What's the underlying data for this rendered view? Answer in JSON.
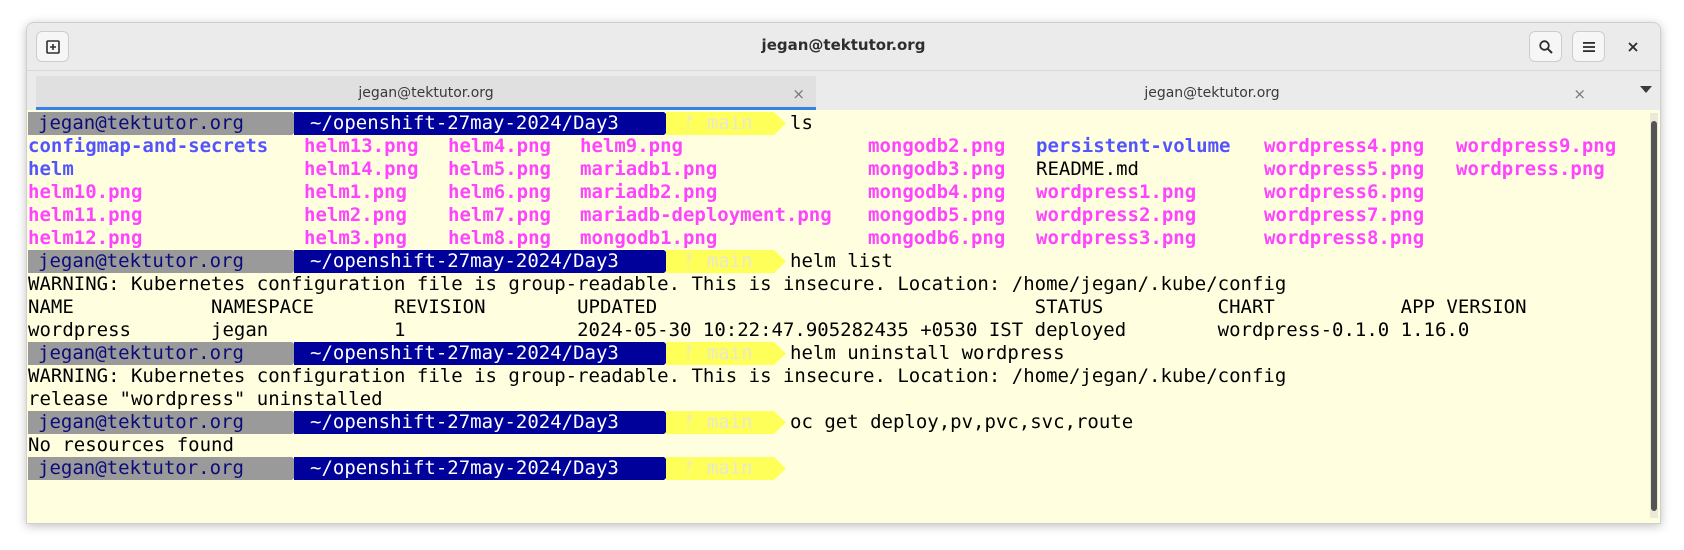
{
  "window": {
    "title": "jegan@tektutor.org"
  },
  "titlebar": {
    "new_tab_icon": "new-tab-icon",
    "search_icon": "search-icon",
    "menu_icon": "hamburger-menu-icon",
    "close_icon": "close-icon"
  },
  "tabs": [
    {
      "label": "jegan@tektutor.org",
      "close": "×",
      "active": true
    },
    {
      "label": "jegan@tektutor.org",
      "close": "×",
      "active": false
    }
  ],
  "prompt": {
    "user": "jegan@tektutor.org",
    "dir": "~/openshift-27may-2024/Day3",
    "git": "ᚠ main"
  },
  "colors": {
    "terminal_bg": "#ffffe0",
    "prompt_user_bg": "#9a9a9a",
    "prompt_dir_bg": "#00009a",
    "prompt_git_bg": "#ffff5a",
    "dir_color": "#5454ff",
    "png_color": "#ff44ff"
  },
  "commands": {
    "c1": "ls",
    "c2": "helm list",
    "c3": "helm uninstall wordpress",
    "c4": "oc get deploy,pv,pvc,svc,route"
  },
  "ls": {
    "col1": [
      "configmap-and-secrets",
      "helm",
      "helm10.png",
      "helm11.png",
      "helm12.png"
    ],
    "col2": [
      "helm13.png",
      "helm14.png",
      "helm1.png",
      "helm2.png",
      "helm3.png"
    ],
    "col3": [
      "helm4.png",
      "helm5.png",
      "helm6.png",
      "helm7.png",
      "helm8.png"
    ],
    "col4": [
      "helm9.png",
      "mariadb1.png",
      "mariadb2.png",
      "mariadb-deployment.png",
      "mongodb1.png"
    ],
    "col5": [
      "mongodb2.png",
      "mongodb3.png",
      "mongodb4.png",
      "mongodb5.png",
      "mongodb6.png"
    ],
    "col6": [
      "persistent-volume",
      "README.md",
      "wordpress1.png",
      "wordpress2.png",
      "wordpress3.png"
    ],
    "col7": [
      "wordpress4.png",
      "wordpress5.png",
      "wordpress6.png",
      "wordpress7.png",
      "wordpress8.png"
    ],
    "col8": [
      "wordpress9.png",
      "wordpress.png"
    ]
  },
  "output": {
    "warning": "WARNING: Kubernetes configuration file is group-readable. This is insecure. Location: /home/jegan/.kube/config",
    "helm_header": "NAME            NAMESPACE       REVISION        UPDATED                                 STATUS          CHART           APP VERSION",
    "helm_row": "wordpress       jegan           1               2024-05-30 10:22:47.905282435 +0530 IST deployed        wordpress-0.1.0 1.16.0",
    "uninstalled": "release \"wordpress\" uninstalled",
    "no_resources": "No resources found"
  }
}
